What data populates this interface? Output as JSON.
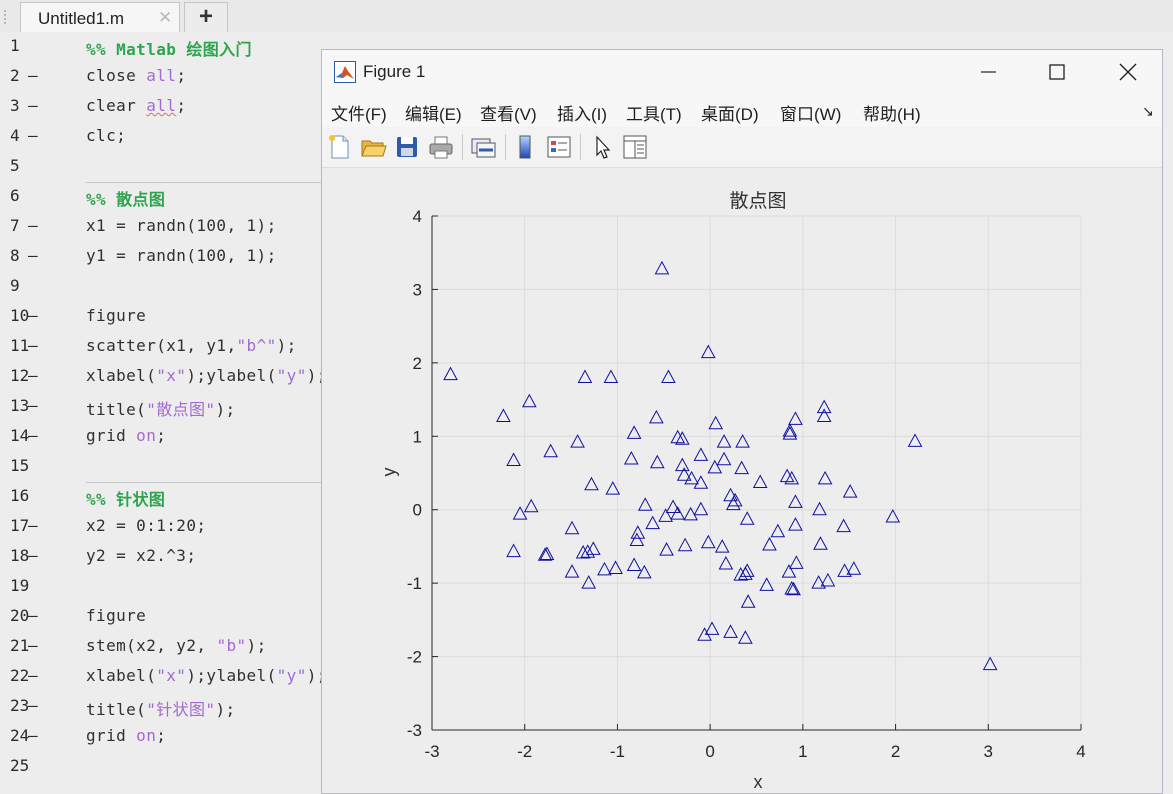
{
  "editor": {
    "tab_title": "Untitled1.m",
    "tab_close_glyph": "✕",
    "new_tab_glyph": "+",
    "lines": [
      {
        "n": "1",
        "exec": "",
        "html": [
          [
            "c",
            "%% Matlab 绘图入门"
          ]
        ]
      },
      {
        "n": "2",
        "exec": "—",
        "html": [
          [
            "p",
            "close "
          ],
          [
            "s",
            "all"
          ],
          [
            "p",
            ";"
          ]
        ]
      },
      {
        "n": "3",
        "exec": "—",
        "html": [
          [
            "p",
            "clear "
          ],
          [
            "su",
            "all"
          ],
          [
            "p",
            ";"
          ]
        ]
      },
      {
        "n": "4",
        "exec": "—",
        "html": [
          [
            "p",
            "clc;"
          ]
        ]
      },
      {
        "n": "5",
        "exec": "",
        "html": []
      },
      {
        "n": "6",
        "exec": "",
        "html": [
          [
            "c",
            "%% 散点图"
          ]
        ]
      },
      {
        "n": "7",
        "exec": "—",
        "html": [
          [
            "p",
            "x1 = randn(100, 1);"
          ]
        ]
      },
      {
        "n": "8",
        "exec": "—",
        "html": [
          [
            "p",
            "y1 = randn(100, 1);"
          ]
        ]
      },
      {
        "n": "9",
        "exec": "",
        "html": []
      },
      {
        "n": "10",
        "exec": "—",
        "html": [
          [
            "p",
            "figure"
          ]
        ]
      },
      {
        "n": "11",
        "exec": "—",
        "html": [
          [
            "p",
            "scatter(x1, y1,"
          ],
          [
            "s",
            "\"b^\""
          ],
          [
            "p",
            ");"
          ]
        ]
      },
      {
        "n": "12",
        "exec": "—",
        "html": [
          [
            "p",
            "xlabel("
          ],
          [
            "s",
            "\"x\""
          ],
          [
            "p",
            ");ylabel("
          ],
          [
            "s",
            "\"y\""
          ],
          [
            "p",
            ");"
          ]
        ]
      },
      {
        "n": "13",
        "exec": "—",
        "html": [
          [
            "p",
            "title("
          ],
          [
            "s",
            "\"散点图\""
          ],
          [
            "p",
            ");"
          ]
        ]
      },
      {
        "n": "14",
        "exec": "—",
        "html": [
          [
            "p",
            "grid "
          ],
          [
            "s",
            "on"
          ],
          [
            "p",
            ";"
          ]
        ]
      },
      {
        "n": "15",
        "exec": "",
        "html": []
      },
      {
        "n": "16",
        "exec": "",
        "html": [
          [
            "c",
            "%% 针状图"
          ]
        ]
      },
      {
        "n": "17",
        "exec": "—",
        "html": [
          [
            "p",
            "x2 = 0:1:20;"
          ]
        ]
      },
      {
        "n": "18",
        "exec": "—",
        "html": [
          [
            "p",
            "y2 = x2.^3;"
          ]
        ]
      },
      {
        "n": "19",
        "exec": "",
        "html": []
      },
      {
        "n": "20",
        "exec": "—",
        "html": [
          [
            "p",
            "figure"
          ]
        ]
      },
      {
        "n": "21",
        "exec": "—",
        "html": [
          [
            "p",
            "stem(x2, y2, "
          ],
          [
            "s",
            "\"b\""
          ],
          [
            "p",
            ");"
          ]
        ]
      },
      {
        "n": "22",
        "exec": "—",
        "html": [
          [
            "p",
            "xlabel("
          ],
          [
            "s",
            "\"x\""
          ],
          [
            "p",
            ");ylabel("
          ],
          [
            "s",
            "\"y\""
          ],
          [
            "p",
            ");"
          ]
        ]
      },
      {
        "n": "23",
        "exec": "—",
        "html": [
          [
            "p",
            "title("
          ],
          [
            "s",
            "\"针状图\""
          ],
          [
            "p",
            ");"
          ]
        ]
      },
      {
        "n": "24",
        "exec": "—",
        "html": [
          [
            "p",
            "grid "
          ],
          [
            "s",
            "on"
          ],
          [
            "p",
            ";"
          ]
        ]
      },
      {
        "n": "25",
        "exec": "",
        "html": []
      }
    ]
  },
  "figure": {
    "title": "Figure 1",
    "logo_icon": "matlab-logo-icon",
    "window_buttons": [
      "minimize-icon",
      "maximize-icon",
      "close-icon"
    ],
    "menus": [
      "文件(F)",
      "编辑(E)",
      "查看(V)",
      "插入(I)",
      "工具(T)",
      "桌面(D)",
      "窗口(W)",
      "帮助(H)"
    ],
    "dock_glyph": "↘",
    "toolbar": [
      "new-figure-icon",
      "open-file-icon",
      "save-icon",
      "print-icon",
      "link-plot-icon",
      "colorbar-icon",
      "legend-icon",
      "pointer-icon",
      "property-inspector-icon"
    ]
  },
  "chart_data": {
    "type": "scatter",
    "title": "散点图",
    "xlabel": "x",
    "ylabel": "y",
    "xlim": [
      -3,
      4
    ],
    "ylim": [
      -3,
      4
    ],
    "xticks": [
      -3,
      -2,
      -1,
      0,
      1,
      2,
      3,
      4
    ],
    "yticks": [
      -3,
      -2,
      -1,
      0,
      1,
      2,
      3,
      4
    ],
    "grid": true,
    "marker": "triangle",
    "color": "#1010a0",
    "series": [
      {
        "x": [
          -0.52,
          -0.02,
          -2.8,
          -1.95,
          -2.23,
          -1.35,
          -1.07,
          -0.45,
          -2.12,
          -1.72,
          -1.43,
          -0.82,
          -0.58,
          -0.35,
          -0.3,
          0.06,
          0.15,
          0.35,
          0.86,
          0.92,
          0.86,
          1.23,
          1.23,
          2.21,
          -0.57,
          -0.85,
          -0.3,
          -0.1,
          0.05,
          0.15,
          0.34,
          0.54,
          0.83,
          1.24,
          1.51,
          -1.28,
          -1.05,
          -0.7,
          -0.4,
          -0.28,
          -0.2,
          -0.1,
          0.22,
          0.27,
          0.88,
          0.92,
          1.18,
          1.97,
          -2.05,
          -1.93,
          -0.62,
          -0.48,
          -0.35,
          -0.1,
          0.25,
          -0.79,
          -0.21,
          0.4,
          0.73,
          0.92,
          1.44,
          -2.12,
          -1.78,
          -1.76,
          -1.49,
          -1.32,
          -1.26,
          -0.78,
          -0.47,
          -0.27,
          -0.02,
          0.13,
          0.4,
          0.64,
          1.19,
          -1.31,
          -1.49,
          -1.14,
          -1.02,
          -0.82,
          -0.71,
          0.17,
          0.33,
          0.41,
          0.61,
          0.85,
          0.88,
          1.17,
          1.27,
          1.45,
          1.55,
          0.38,
          0.9,
          0.93,
          -0.06,
          0.02,
          0.22,
          0.38,
          3.02,
          -1.37
        ],
        "y": [
          3.28,
          2.14,
          1.84,
          1.47,
          1.27,
          1.8,
          1.8,
          1.8,
          0.67,
          0.79,
          0.92,
          1.04,
          1.25,
          0.98,
          0.96,
          1.17,
          0.92,
          0.92,
          1.03,
          1.23,
          1.07,
          1.39,
          1.27,
          0.93,
          0.64,
          0.69,
          0.6,
          0.74,
          0.57,
          0.68,
          0.56,
          0.37,
          0.45,
          0.42,
          0.24,
          0.34,
          0.28,
          0.06,
          0.03,
          0.47,
          0.42,
          0.36,
          0.19,
          0.12,
          0.42,
          0.1,
          0.0,
          -0.1,
          -0.06,
          0.04,
          -0.19,
          -0.09,
          -0.06,
          0.0,
          0.07,
          -0.42,
          -0.07,
          -0.13,
          -0.3,
          -0.21,
          -0.23,
          -0.57,
          -0.62,
          -0.61,
          -0.26,
          -0.58,
          -0.54,
          -0.32,
          -0.55,
          -0.49,
          -0.45,
          -0.51,
          -0.84,
          -0.48,
          -0.47,
          -1.0,
          -0.85,
          -0.82,
          -0.8,
          -0.76,
          -0.86,
          -0.74,
          -0.89,
          -1.26,
          -1.03,
          -0.85,
          -1.08,
          -1.0,
          -0.97,
          -0.84,
          -0.81,
          -1.75,
          -1.09,
          -0.73,
          -1.71,
          -1.63,
          -1.67,
          -0.88,
          -2.11,
          -0.59
        ]
      }
    ]
  }
}
